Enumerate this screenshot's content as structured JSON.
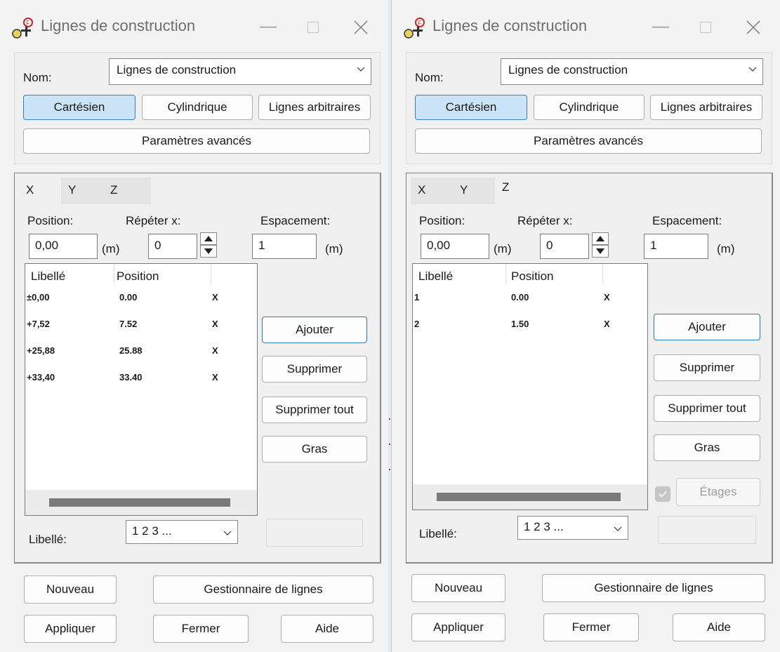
{
  "windows": [
    {
      "title": "Lignes de construction",
      "nom_label": "Nom:",
      "nom_value": "Lignes de construction",
      "modes": {
        "cartesien": "Cartésien",
        "cylindrique": "Cylindrique",
        "arbitraires": "Lignes arbitraires"
      },
      "advanced": "Paramètres avancés",
      "tabs": [
        "X",
        "Y",
        "Z"
      ],
      "active_tab": "X",
      "position_label": "Position:",
      "position_value": "0,00",
      "unit_m": "(m)",
      "repeter_label": "Répéter x:",
      "repeter_value": "0",
      "espacement_label": "Espacement:",
      "espacement_value": "1",
      "unit_m2": "(m)",
      "list_headers": [
        "Libellé",
        "Position"
      ],
      "rows": [
        {
          "label": "±0,00",
          "position": "0.00",
          "flag": "X"
        },
        {
          "label": "+7,52",
          "position": "7.52",
          "flag": "X"
        },
        {
          "label": "+25,88",
          "position": "25.88",
          "flag": "X"
        },
        {
          "label": "+33,40",
          "position": "33.40",
          "flag": "X"
        }
      ],
      "buttons": {
        "ajouter": "Ajouter",
        "supprimer": "Supprimer",
        "supprimer_tout": "Supprimer tout",
        "gras": "Gras"
      },
      "libelle_label": "Libellé:",
      "libelle_value": "1 2 3 ...",
      "bottom": {
        "nouveau": "Nouveau",
        "gestionnaire": "Gestionnaire de lignes",
        "appliquer": "Appliquer",
        "fermer": "Fermer",
        "aide": "Aide"
      }
    },
    {
      "title": "Lignes de construction",
      "nom_label": "Nom:",
      "nom_value": "Lignes de construction",
      "modes": {
        "cartesien": "Cartésien",
        "cylindrique": "Cylindrique",
        "arbitraires": "Lignes arbitraires"
      },
      "advanced": "Paramètres avancés",
      "tabs": [
        "X",
        "Y",
        "Z"
      ],
      "active_tab": "Z",
      "position_label": "Position:",
      "position_value": "0,00",
      "unit_m": "(m)",
      "repeter_label": "Répéter x:",
      "repeter_value": "0",
      "espacement_label": "Espacement:",
      "espacement_value": "1",
      "unit_m2": "(m)",
      "list_headers": [
        "Libellé",
        "Position"
      ],
      "rows": [
        {
          "label": "1",
          "position": "0.00",
          "flag": "X"
        },
        {
          "label": "2",
          "position": "1.50",
          "flag": "X"
        }
      ],
      "buttons": {
        "ajouter": "Ajouter",
        "supprimer": "Supprimer",
        "supprimer_tout": "Supprimer tout",
        "gras": "Gras",
        "etages": "Étages"
      },
      "libelle_label": "Libellé:",
      "libelle_value": "1 2 3 ...",
      "bottom": {
        "nouveau": "Nouveau",
        "gestionnaire": "Gestionnaire de lignes",
        "appliquer": "Appliquer",
        "fermer": "Fermer",
        "aide": "Aide"
      }
    }
  ]
}
